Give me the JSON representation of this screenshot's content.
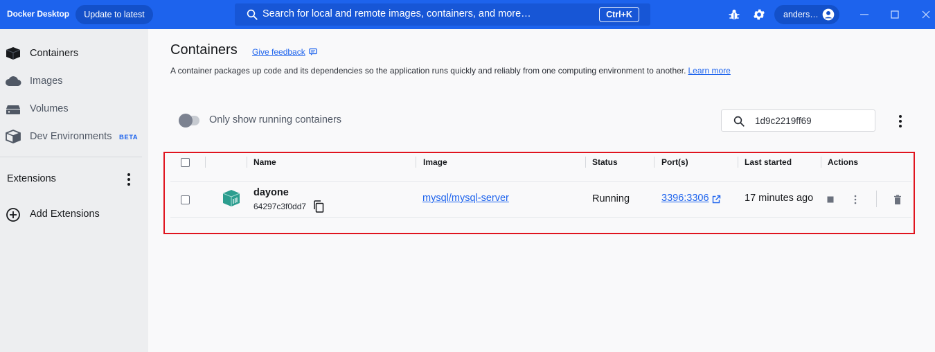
{
  "topbar": {
    "app_title": "Docker Desktop",
    "update_label": "Update to latest",
    "search_placeholder": "Search for local and remote images, containers, and more…",
    "shortcut": "Ctrl+K",
    "user_name": "anders…",
    "icons": [
      "search-icon",
      "bug-icon",
      "gear-icon",
      "user-avatar-icon",
      "minimize-icon",
      "maximize-icon",
      "close-icon"
    ]
  },
  "sidebar": {
    "items": [
      {
        "label": "Containers",
        "icon": "container-icon",
        "active": true
      },
      {
        "label": "Images",
        "icon": "cloud-icon"
      },
      {
        "label": "Volumes",
        "icon": "volume-icon"
      },
      {
        "label": "Dev Environments",
        "icon": "dev-env-icon",
        "badge": "BETA"
      }
    ],
    "extensions_label": "Extensions",
    "add_extensions_label": "Add Extensions"
  },
  "main": {
    "title": "Containers",
    "feedback_label": "Give feedback",
    "description": "A container packages up code and its dependencies so the application runs quickly and reliably from one computing environment to another.",
    "learn_more": "Learn more",
    "toggle_label": "Only show running containers",
    "toggle_on": false,
    "filter_value": "1d9c2219ff69"
  },
  "table": {
    "headers": {
      "name": "Name",
      "image": "Image",
      "status": "Status",
      "ports": "Port(s)",
      "last_started": "Last started",
      "actions": "Actions"
    },
    "rows": [
      {
        "name": "dayone",
        "id": "64297c3f0dd7",
        "image": "mysql/mysql-server",
        "status": "Running",
        "ports": "3396:3306",
        "last_started": "17 minutes ago"
      }
    ]
  },
  "colors": {
    "accent": "#1d63ed",
    "highlight_border": "#e0141e",
    "container_running": "#2c9e8f"
  }
}
